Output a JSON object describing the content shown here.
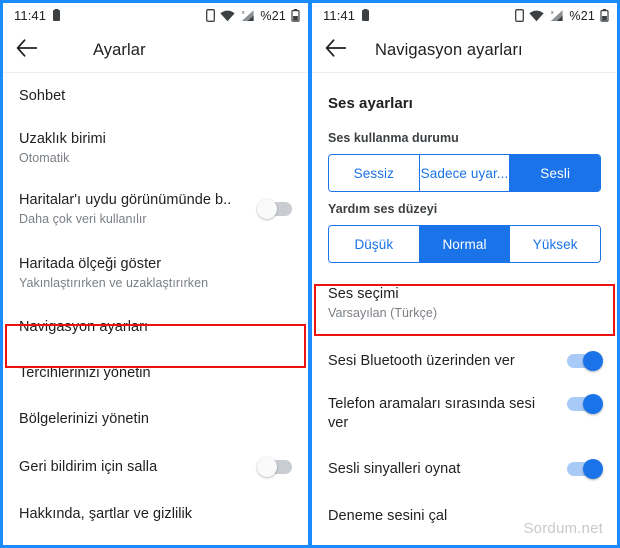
{
  "status_bar": {
    "time": "11:41",
    "battery_small_icon": "battery-charging-icon",
    "sim_icon": "sim-card-icon",
    "wifi_icon": "wifi-icon",
    "signal_icon": "cellular-signal-icon",
    "signal_superscript": "x",
    "battery_percent": "%21",
    "battery_icon": "battery-icon"
  },
  "left_screen": {
    "appbar": {
      "back_icon": "back-arrow-icon",
      "title": "Ayarlar"
    },
    "items": [
      {
        "title": "Sohbet",
        "subtitle": "",
        "toggle": null
      },
      {
        "title": "Uzaklık birimi",
        "subtitle": "Otomatik",
        "toggle": null
      },
      {
        "title": "Haritalar'ı uydu görünümünde b..",
        "subtitle": "Daha çok veri kullanılır",
        "toggle": "off"
      },
      {
        "title": "Haritada ölçeği göster",
        "subtitle": "Yakınlaştırırken ve uzaklaştırırken",
        "toggle": null
      },
      {
        "title": "Navigasyon ayarları",
        "subtitle": "",
        "toggle": null
      },
      {
        "title": "Tercihlerinizi yönetin",
        "subtitle": "",
        "toggle": null
      },
      {
        "title": "Bölgelerinizi yönetin",
        "subtitle": "",
        "toggle": null
      },
      {
        "title": "Geri bildirim için salla",
        "subtitle": "",
        "toggle": "off"
      },
      {
        "title": "Hakkında, şartlar ve gizlilik",
        "subtitle": "",
        "toggle": null
      }
    ],
    "highlight_item_index": 4
  },
  "right_screen": {
    "appbar": {
      "back_icon": "back-arrow-icon",
      "title": "Navigasyon ayarları"
    },
    "section_title": "Ses ayarları",
    "sound_mode": {
      "label": "Ses kullanma durumu",
      "options": [
        "Sessiz",
        "Sadece uyar...",
        "Sesli"
      ],
      "selected": "Sesli"
    },
    "guidance_volume": {
      "label": "Yardım ses düzeyi",
      "options": [
        "Düşük",
        "Normal",
        "Yüksek"
      ],
      "selected": "Normal"
    },
    "items": [
      {
        "title": "Ses seçimi",
        "subtitle": "Varsayılan (Türkçe)",
        "toggle": null
      },
      {
        "title": "Sesi Bluetooth üzerinden ver",
        "subtitle": "",
        "toggle": "on"
      },
      {
        "title": "Telefon aramaları sırasında sesi ver",
        "subtitle": "",
        "toggle": "on"
      },
      {
        "title": "Sesli sinyalleri oynat",
        "subtitle": "",
        "toggle": "on"
      },
      {
        "title": "Deneme sesini çal",
        "subtitle": "",
        "toggle": null
      }
    ],
    "highlight_item_index": 0
  },
  "watermark": "Sordum.net",
  "colors": {
    "accent_blue": "#1a73e8",
    "frame_blue": "#1a8cff",
    "highlight_red": "#ee1111",
    "toggle_on_track": "#a8caf7",
    "toggle_off_track": "#c9cdd1"
  }
}
